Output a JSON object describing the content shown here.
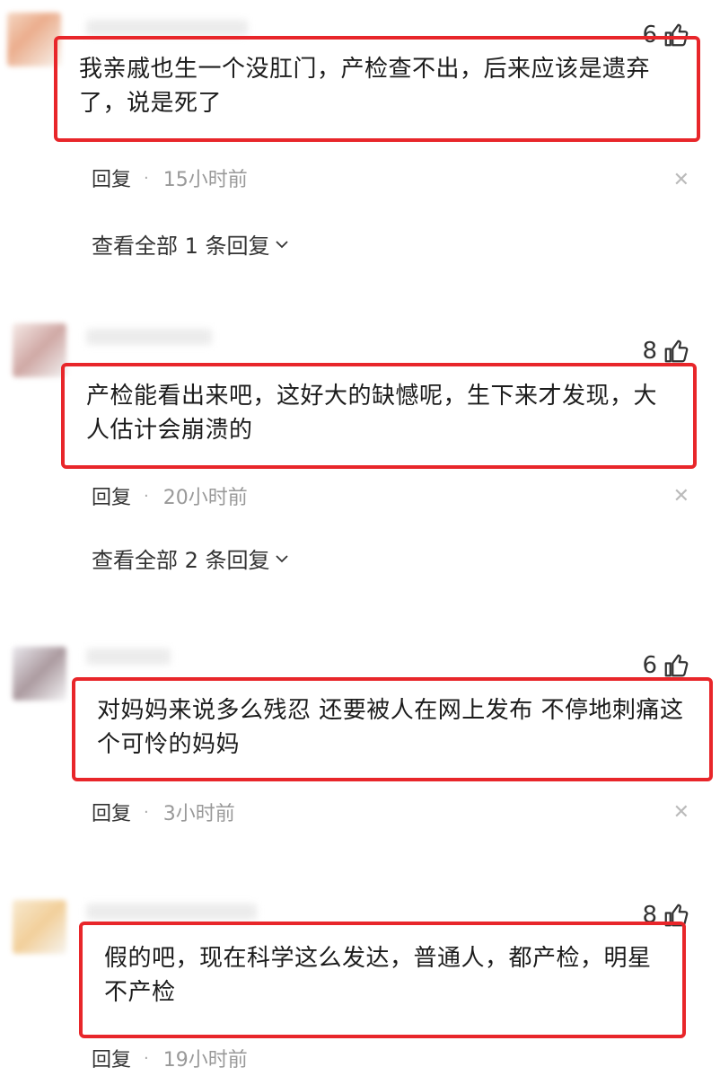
{
  "comments": [
    {
      "likes": "6",
      "text": "我亲戚也生一个没肛门，产检查不出，后来应该是遗弃了，说是死了",
      "reply_label": "回复",
      "time": "15小时前",
      "view_replies": "查看全部 1 条回复"
    },
    {
      "likes": "8",
      "text": "产检能看出来吧，这好大的缺憾呢，生下来才发现，大人估计会崩溃的",
      "reply_label": "回复",
      "time": "20小时前",
      "view_replies": "查看全部 2 条回复"
    },
    {
      "likes": "6",
      "text": "对妈妈来说多么残忍 还要被人在网上发布 不停地刺痛这个可怜的妈妈",
      "reply_label": "回复",
      "time": "3小时前"
    },
    {
      "likes": "8",
      "text": "假的吧，现在科学这么发达，普通人，都产检，明星不产检",
      "reply_label": "回复",
      "time": "19小时前"
    }
  ],
  "icons": {
    "like": "thumbs-up-icon",
    "close": "close-icon",
    "chevron": "chevron-down-icon"
  },
  "colors": {
    "highlight_border": "#e8262a",
    "time_text": "#999999"
  }
}
